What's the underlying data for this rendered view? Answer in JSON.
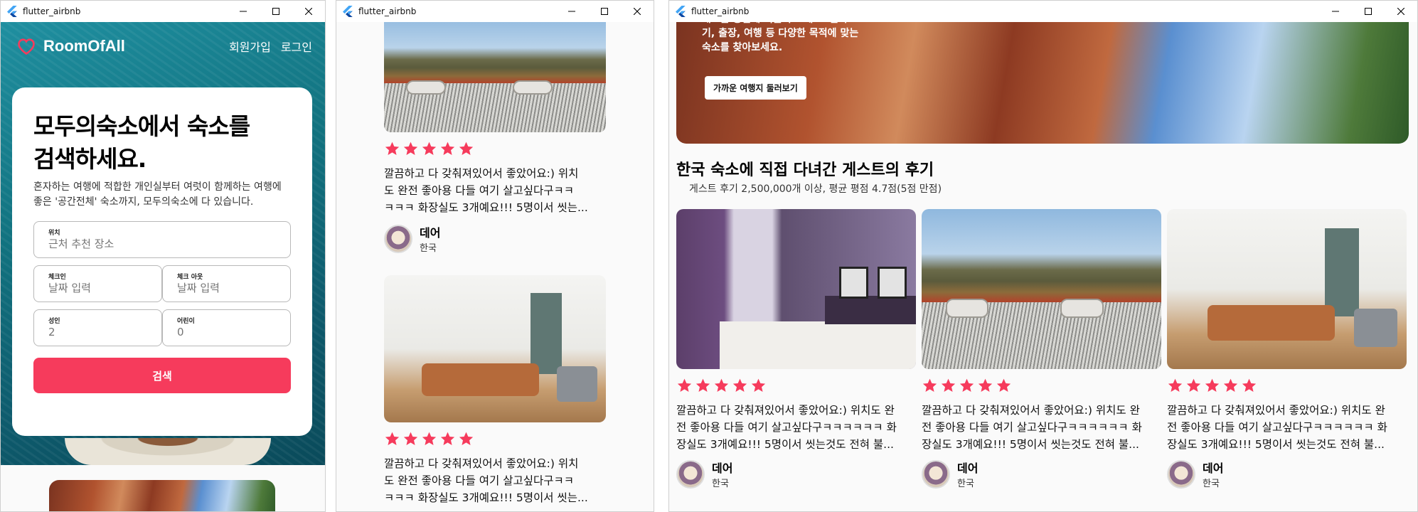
{
  "app": {
    "window_title": "flutter_airbnb"
  },
  "colors": {
    "brand": "#f63b5c",
    "star": "#f63b5c"
  },
  "nav": {
    "brand": "RoomOfAll",
    "signup": "회원가입",
    "login": "로그인"
  },
  "search": {
    "title_line1": "모두의숙소에서 숙소를",
    "title_line2": "검색하세요.",
    "subtitle": "혼자하는 여행에 적합한 개인실부터 여럿이 함께하는 여행에 좋은 '공간전체' 숙소까지, 모두의숙소에 다 있습니다.",
    "location_label": "위치",
    "location_placeholder": "근처 추천 장소",
    "checkin_label": "체크인",
    "checkin_placeholder": "날짜 입력",
    "checkout_label": "체크 아웃",
    "checkout_placeholder": "날짜 입력",
    "adults_label": "성인",
    "adults_value": "2",
    "children_label": "어린이",
    "children_value": "0",
    "button": "검색"
  },
  "hero": {
    "text": "새로운 공간에 머물러 보세요. 살아보기, 출장, 여행 등 다양한 목적에 맞는 숙소를 찾아보세요.",
    "button": "가까운 여행지 둘러보기"
  },
  "reviews_section": {
    "title": "한국 숙소에 직접 다녀간 게스트의 후기",
    "subtitle": "게스트 후기 2,500,000개 이상, 평균 평점 4.7점(5점 만점)"
  },
  "review": {
    "rating": 5,
    "text": "깔끔하고 다 갖춰져있어서 좋았어요:) 위치도 완전 좋아용 다들 여기 살고싶다구ㅋㅋㅋㅋㅋㅋ 화장실도 3개예요!!! 5명이서 씻는것도 전혀 불...",
    "author": "데어",
    "country": "한국"
  },
  "window2_review": {
    "text_line1": "깔끔하고 다 갖춰져있어서 좋았어요:) 위치",
    "text_line2": "도 완전 좋아용 다들 여기 살고싶다구ㅋㅋ",
    "text_line3": "ㅋㅋㅋ 화장실도 3개예요!!! 5명이서 씻는..."
  },
  "window3_review": {
    "text_line1": "깔끔하고 다 갖춰져있어서 좋았어요:) 위치도 완",
    "text_line2": "전 좋아용 다들 여기 살고싶다구ㅋㅋㅋㅋㅋㅋ 화",
    "text_line3": "장실도 3개예요!!! 5명이서 씻는것도 전혀 불..."
  }
}
